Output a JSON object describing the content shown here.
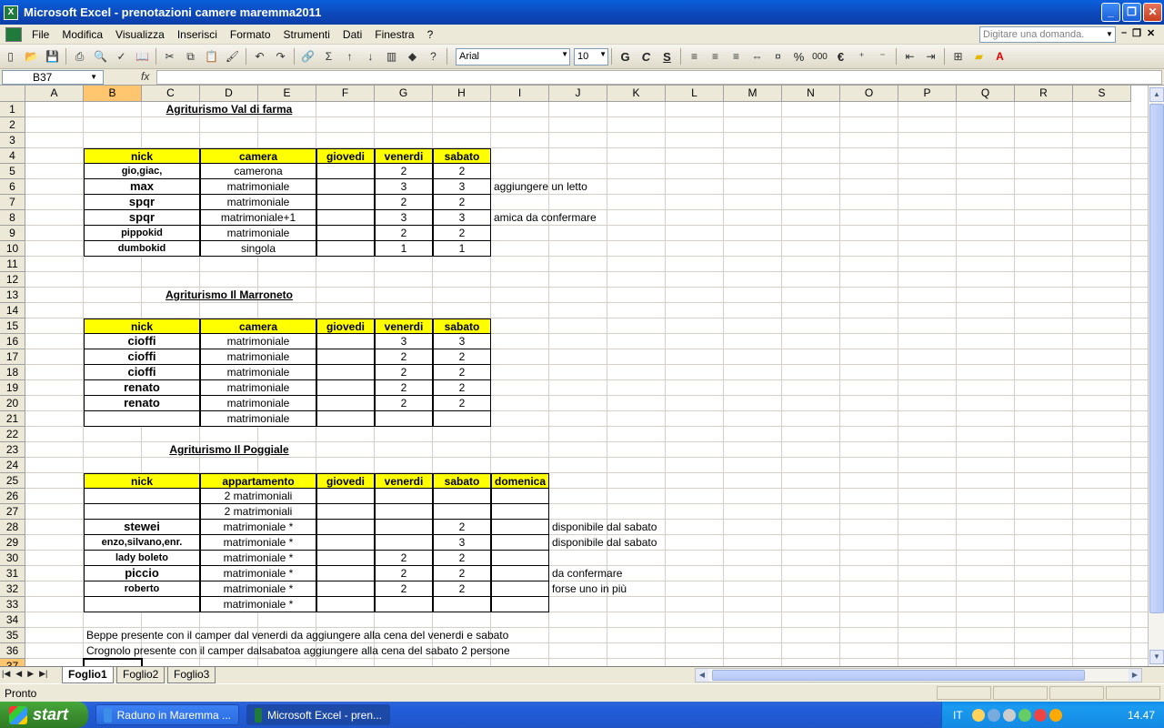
{
  "window": {
    "title": "Microsoft Excel - prenotazioni camere maremma2011",
    "app_icon": "excel-icon"
  },
  "menu": {
    "items": [
      "File",
      "Modifica",
      "Visualizza",
      "Inserisci",
      "Formato",
      "Strumenti",
      "Dati",
      "Finestra",
      "?"
    ],
    "help_placeholder": "Digitare una domanda."
  },
  "format": {
    "font": "Arial",
    "size": "10",
    "bold": "G",
    "italic": "C",
    "underline": "S",
    "percent": "%",
    "thousands": "000",
    "euro": "€"
  },
  "formula": {
    "namebox": "B37",
    "fx": "fx",
    "value": ""
  },
  "columns": [
    "A",
    "B",
    "C",
    "D",
    "E",
    "F",
    "G",
    "H",
    "I",
    "J",
    "K",
    "L",
    "M",
    "N",
    "O",
    "P",
    "Q",
    "R",
    "S"
  ],
  "rows": [
    "1",
    "2",
    "3",
    "4",
    "5",
    "6",
    "7",
    "8",
    "9",
    "10",
    "11",
    "12",
    "13",
    "14",
    "15",
    "16",
    "17",
    "18",
    "19",
    "20",
    "21",
    "22",
    "23",
    "24",
    "25",
    "26",
    "27",
    "28",
    "29",
    "30",
    "31",
    "32",
    "33",
    "34",
    "35",
    "36",
    "37"
  ],
  "selected": {
    "col": "B",
    "row": "37"
  },
  "section1": {
    "title": "Agriturismo Val di farma",
    "headers": [
      "nick",
      "camera",
      "giovedi",
      "venerdi",
      "sabato"
    ],
    "rows": [
      [
        "gio,giac,",
        "camerona",
        "",
        "2",
        "2",
        ""
      ],
      [
        "max",
        "matrimoniale",
        "",
        "3",
        "3",
        "aggiungere un letto"
      ],
      [
        "spqr",
        "matrimoniale",
        "",
        "2",
        "2",
        ""
      ],
      [
        "spqr",
        "matrimoniale+1",
        "",
        "3",
        "3",
        "amica da confermare"
      ],
      [
        "pippokid",
        "matrimoniale",
        "",
        "2",
        "2",
        ""
      ],
      [
        "dumbokid",
        "singola",
        "",
        "1",
        "1",
        ""
      ]
    ]
  },
  "section2": {
    "title": "Agriturismo Il Marroneto",
    "headers": [
      "nick",
      "camera",
      "giovedi",
      "venerdi",
      "sabato"
    ],
    "rows": [
      [
        "cioffi",
        "matrimoniale",
        "",
        "3",
        "3"
      ],
      [
        "cioffi",
        "matrimoniale",
        "",
        "2",
        "2"
      ],
      [
        "cioffi",
        "matrimoniale",
        "",
        "2",
        "2"
      ],
      [
        "renato",
        "matrimoniale",
        "",
        "2",
        "2"
      ],
      [
        "renato",
        "matrimoniale",
        "",
        "2",
        "2"
      ],
      [
        "",
        "matrimoniale",
        "",
        "",
        ""
      ]
    ]
  },
  "section3": {
    "title": "Agriturismo Il Poggiale",
    "headers": [
      "nick",
      "appartamento",
      "giovedi",
      "venerdi",
      "sabato",
      "domenica"
    ],
    "rows": [
      [
        "",
        "2 matrimoniali",
        "",
        "",
        "",
        "",
        ""
      ],
      [
        "",
        "2 matrimoniali",
        "",
        "",
        "",
        "",
        ""
      ],
      [
        "stewei",
        "matrimoniale  *",
        "",
        "",
        "2",
        "",
        "disponibile dal sabato"
      ],
      [
        "enzo,silvano,enr.",
        "matrimoniale  *",
        "",
        "",
        "3",
        "",
        "disponibile dal sabato"
      ],
      [
        "lady boleto",
        "matrimoniale  *",
        "",
        "2",
        "2",
        "",
        ""
      ],
      [
        "piccio",
        "matrimoniale  *",
        "",
        "2",
        "2",
        "",
        "da confermare"
      ],
      [
        "roberto",
        "matrimoniale  *",
        "",
        "2",
        "2",
        "",
        "forse uno in più"
      ],
      [
        "",
        "matrimoniale  *",
        "",
        "",
        "",
        "",
        ""
      ]
    ]
  },
  "notes": [
    "Beppe presente con il camper dal venerdi da aggiungere alla cena del venerdi e sabato",
    "Crognolo presente con il camper dalsabatoa aggiungere alla cena del sabato 2 persone"
  ],
  "sheets": [
    "Foglio1",
    "Foglio2",
    "Foglio3"
  ],
  "status": "Pronto",
  "taskbar": {
    "start": "start",
    "items": [
      "Raduno in Maremma ...",
      "Microsoft Excel - pren..."
    ],
    "lang": "IT",
    "clock": "14.47"
  }
}
